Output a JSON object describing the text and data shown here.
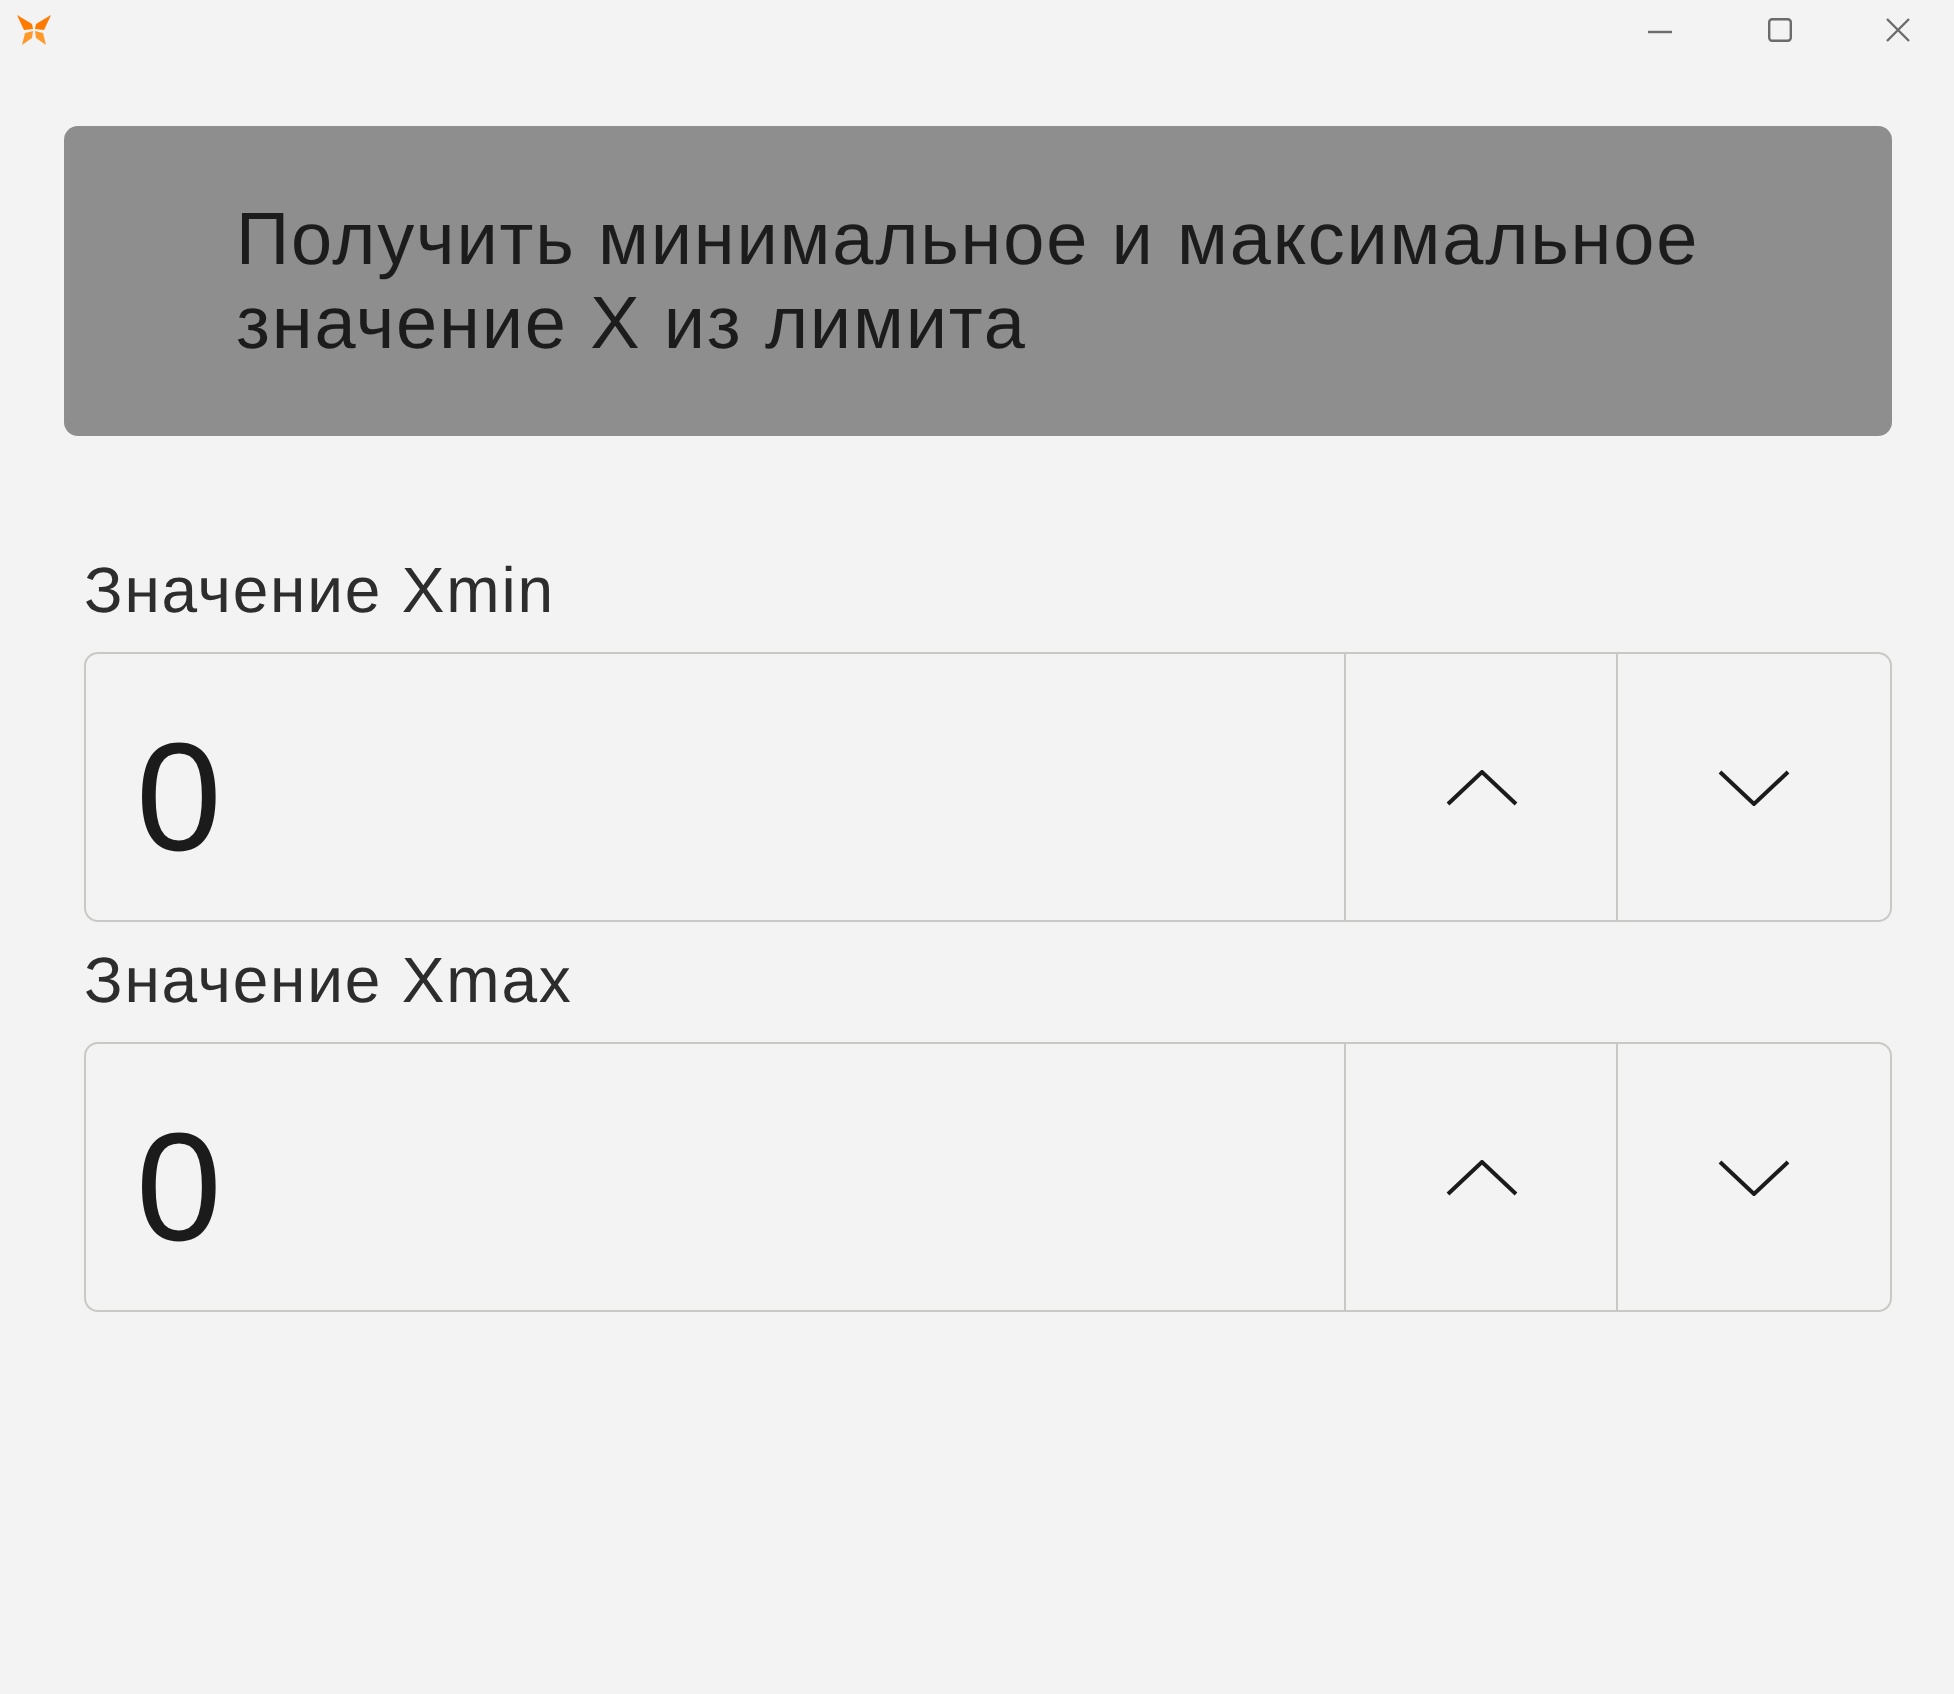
{
  "action_button": {
    "label": "Получить минимальное и максимальное значение X из лимита"
  },
  "fields": [
    {
      "label": "Значение Xmin",
      "value": "0"
    },
    {
      "label": "Значение Xmax",
      "value": "0"
    }
  ]
}
